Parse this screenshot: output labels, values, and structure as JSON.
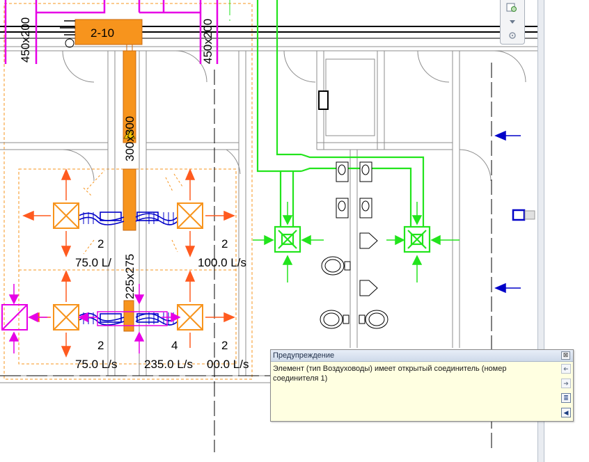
{
  "drawing": {
    "tag_room": "2-10",
    "duct_sizes": {
      "left_vertical": "450x200",
      "right_vertical": "450x200",
      "main_upper": "300x300",
      "main_lower": "225x275"
    },
    "diffuser_labels": [
      {
        "count": "2",
        "flow": "75.0 L/"
      },
      {
        "count": "2",
        "flow": "100.0 L/s"
      },
      {
        "count": "2",
        "flow": "75.0 L/s"
      },
      {
        "count": "4",
        "flow": "235.0 L/s"
      },
      {
        "count": "2",
        "flow": "00.0 L/s"
      }
    ]
  },
  "colors": {
    "supply_duct": "#f7941d",
    "exhaust_green": "#22e41c",
    "magenta": "#e600e6",
    "blue_flex": "#0000c8",
    "wall": "#8c8c8c",
    "arrow_orange": "#ff5a1f"
  },
  "nav_bar": {
    "icons": [
      "zoom-window-icon",
      "dropdown-arrow-icon",
      "settings-icon"
    ]
  },
  "warning_dialog": {
    "title": "Предупреждение",
    "message": "Элемент (тип Воздуховоды) имеет открытый соединитель (номер соединителя 1)",
    "close_symbol": "⊠",
    "buttons": [
      {
        "name": "prev-button",
        "symbol": "➜"
      },
      {
        "name": "next-button",
        "symbol": "➜"
      },
      {
        "name": "show-details-button",
        "symbol": "≣"
      },
      {
        "name": "sound-button",
        "symbol": "◀"
      }
    ]
  }
}
